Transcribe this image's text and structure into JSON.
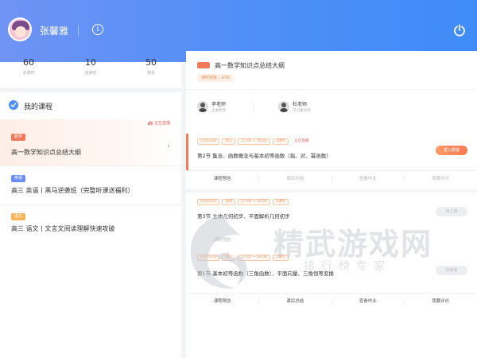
{
  "header": {
    "username": "张馨雅",
    "info_icon": "info-icon",
    "power_icon": "power-icon",
    "gradient": [
      "#6f93f5",
      "#3f8cf8"
    ]
  },
  "stats": [
    {
      "value": "60",
      "label": "总课时"
    },
    {
      "value": "10",
      "label": "总课时"
    },
    {
      "value": "50",
      "label": "剩余"
    }
  ],
  "my_courses": {
    "title": "我的课程",
    "items": [
      {
        "tag": "数学",
        "tag_color": "#f07a5a",
        "name": "高一数学知识点总结大纲",
        "live_label": "正在直播",
        "active": true
      },
      {
        "tag": "英语",
        "tag_color": "#6a8ef5",
        "name": "高三 英语丨黑马逆袭班（完整听课送福利）",
        "active": false
      },
      {
        "tag": "语文",
        "tag_color": "#f5b35a",
        "name": "高三 语文丨文言文阅读理解快速攻破",
        "active": false
      }
    ]
  },
  "detail": {
    "title": "高一数学知识点总结大纲",
    "sub_tag": "课时进度：2/30",
    "teachers": [
      {
        "name": "李老师",
        "role": "主讲老师"
      },
      {
        "name": "杜老师",
        "role": "学习督导师"
      }
    ]
  },
  "lessons": [
    {
      "meta": [
        "03月03日",
        "周三",
        "17:00 ~ 18:00",
        "2课时"
      ],
      "live_label": "正在直播",
      "title": "第2节 集合、函数概念与基本初等函数（指、对、幂函数）",
      "button": "进入教室",
      "actions": [
        "课程预告",
        "课后总结",
        "查看作业",
        "我要评价"
      ]
    },
    {
      "meta": [
        "03月04日",
        "周四",
        "17:00 ~ 18:00",
        "2课时"
      ],
      "title": "第3节 立体几何初步、平面解析几何初步",
      "button": "待上课",
      "actions": [
        "课程预告"
      ]
    },
    {
      "meta": [
        "03月02日",
        "周四",
        "17:00 ~ 18:00",
        "2课时"
      ],
      "title": "第1节 基本初等函数（三角函数）、平面向量、三角恒等变换",
      "button": "已结束",
      "actions": [
        "课程预告",
        "课后总结",
        "查看作业",
        "我要评价"
      ]
    }
  ],
  "watermark": {
    "title": "精武游戏网",
    "subtitle": "排行榜专家"
  },
  "colors": {
    "accent_orange": "#f87a52",
    "accent_blue": "#4e8ef7"
  }
}
